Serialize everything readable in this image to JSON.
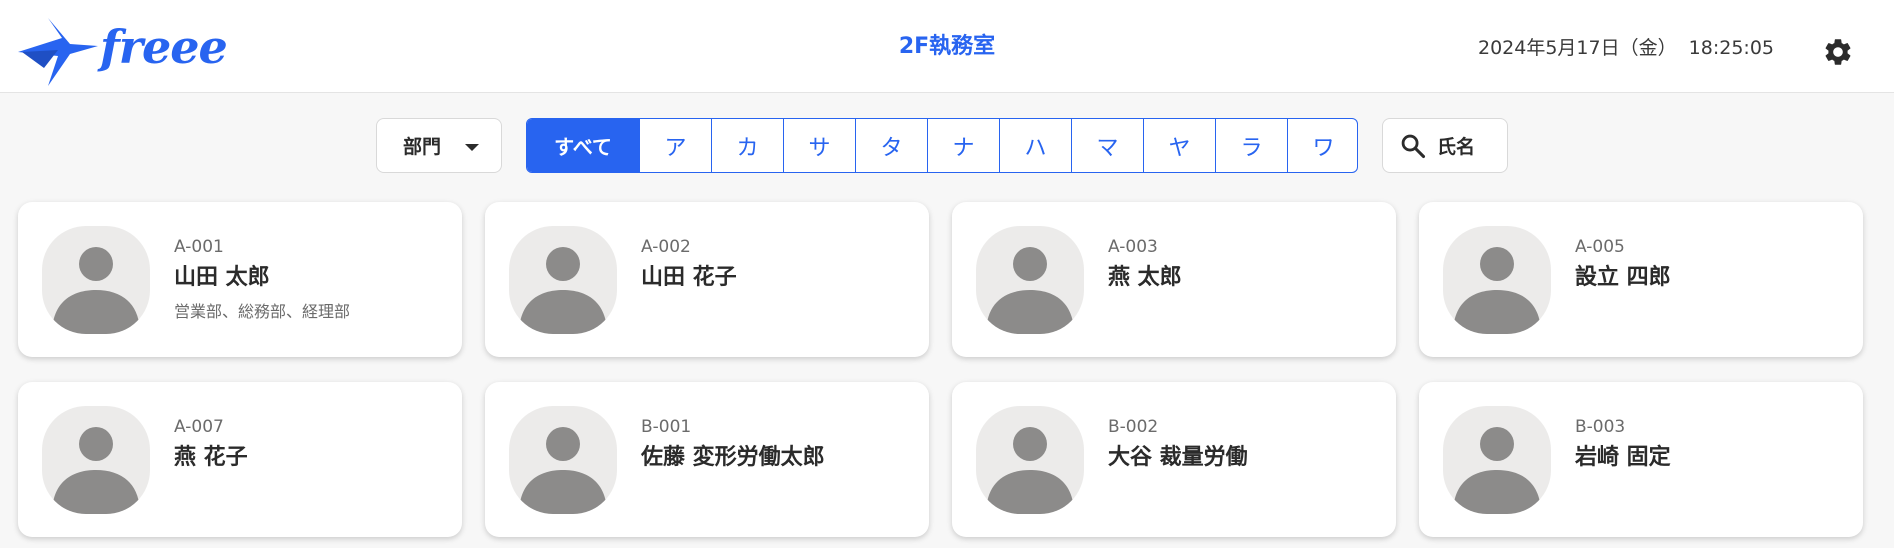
{
  "header": {
    "logo_text": "freee",
    "room_title": "2F執務室",
    "date": "2024年5月17日（金）",
    "time": "18:25:05",
    "settings_icon": "gear-icon",
    "brand_color": "#2864f0"
  },
  "filters": {
    "department_label": "部門",
    "department_icon": "chevron-down-icon",
    "kana_tabs": [
      "すべて",
      "ア",
      "カ",
      "サ",
      "タ",
      "ナ",
      "ハ",
      "マ",
      "ヤ",
      "ラ",
      "ワ"
    ],
    "active_tab": "すべて",
    "name_search_label": "氏名",
    "name_search_icon": "search-icon"
  },
  "employees": [
    {
      "code": "A-001",
      "name": "山田 太郎",
      "departments": "営業部、総務部、経理部"
    },
    {
      "code": "A-002",
      "name": "山田 花子",
      "departments": ""
    },
    {
      "code": "A-003",
      "name": "燕 太郎",
      "departments": ""
    },
    {
      "code": "A-005",
      "name": "設立 四郎",
      "departments": ""
    },
    {
      "code": "A-007",
      "name": "燕 花子",
      "departments": ""
    },
    {
      "code": "B-001",
      "name": "佐藤 変形労働太郎",
      "departments": ""
    },
    {
      "code": "B-002",
      "name": "大谷 裁量労働",
      "departments": ""
    },
    {
      "code": "B-003",
      "name": "岩崎 固定",
      "departments": ""
    }
  ]
}
